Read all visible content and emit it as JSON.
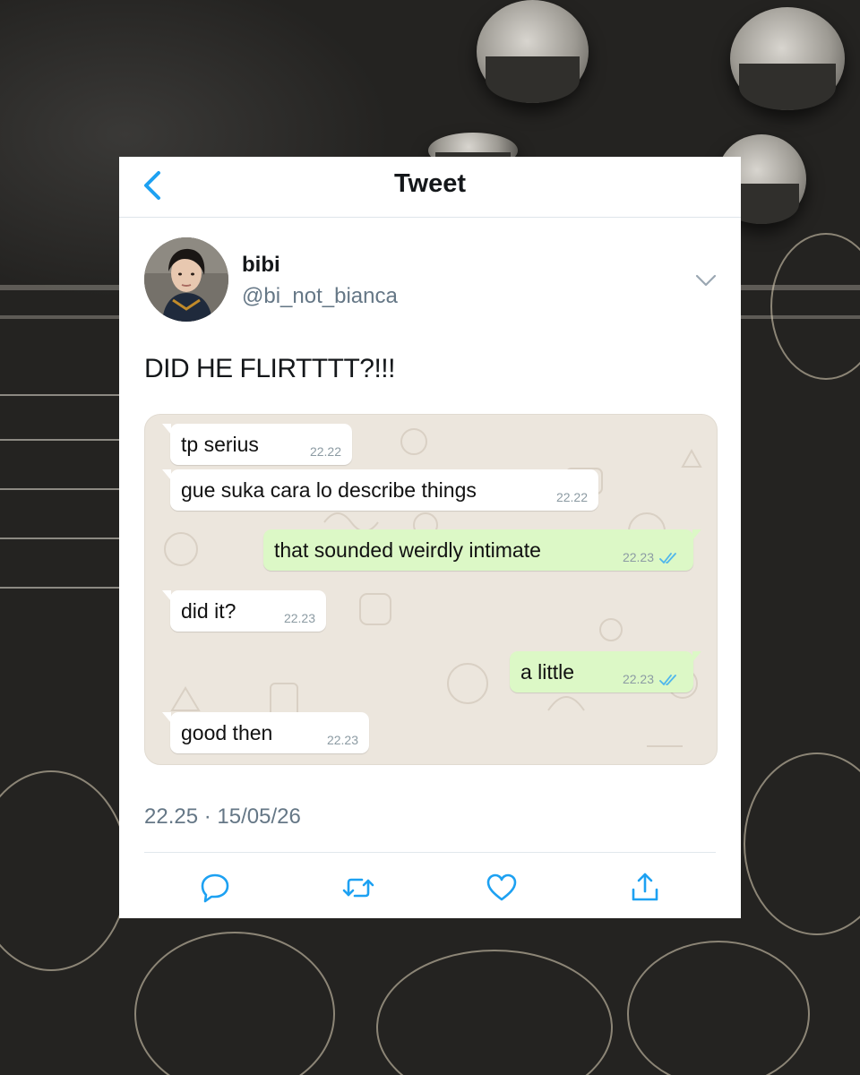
{
  "header": {
    "back_icon": "chevron-left-icon",
    "title": "Tweet"
  },
  "tweet": {
    "author_name": "bibi",
    "author_handle": "@bi_not_bianca",
    "menu_icon": "chevron-down-icon",
    "text": "DID HE FLIRTTTT?!!!",
    "timestamp": "22.25 · 15/05/26"
  },
  "chat": {
    "messages": [
      {
        "direction": "in",
        "text": "tp serius",
        "time": "22.22"
      },
      {
        "direction": "in",
        "text": "gue suka cara lo describe things",
        "time": "22.22"
      },
      {
        "direction": "out",
        "text": "that sounded weirdly intimate",
        "time": "22.23",
        "status": "read"
      },
      {
        "direction": "in",
        "text": "did it?",
        "time": "22.23"
      },
      {
        "direction": "out",
        "text": "a little",
        "time": "22.23",
        "status": "read"
      },
      {
        "direction": "in",
        "text": "good then",
        "time": "22.23"
      }
    ]
  },
  "actions": [
    {
      "name": "reply",
      "icon": "reply-icon"
    },
    {
      "name": "retweet",
      "icon": "retweet-icon"
    },
    {
      "name": "like",
      "icon": "heart-icon"
    },
    {
      "name": "share",
      "icon": "share-icon"
    }
  ],
  "colors": {
    "accent": "#1da1f2",
    "text_primary": "#14171a",
    "text_secondary": "#657786",
    "outgoing_bubble": "#dcf8c6",
    "incoming_bubble": "#ffffff",
    "chat_background": "#ece6dd",
    "read_ticks": "#4fb6ec"
  }
}
